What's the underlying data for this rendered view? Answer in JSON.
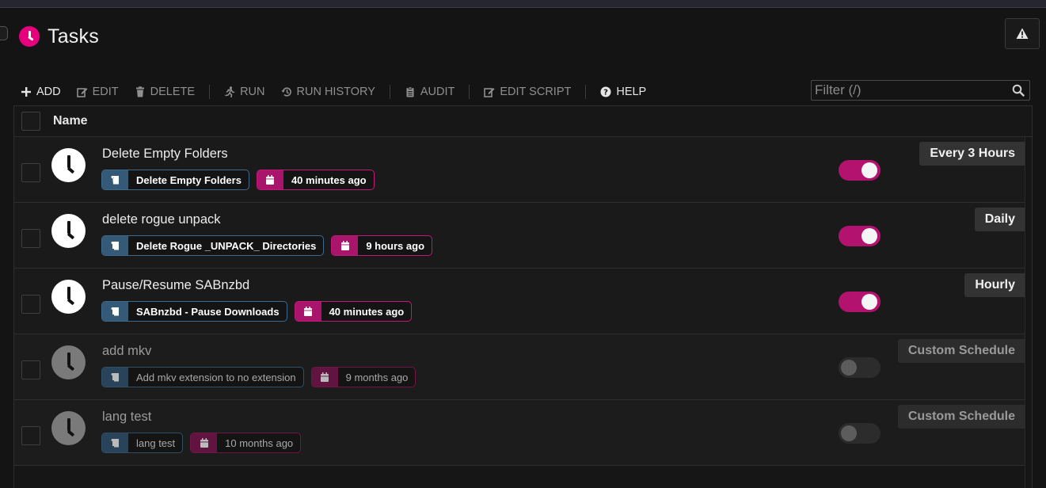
{
  "page": {
    "title": "Tasks"
  },
  "toolbar": {
    "add": "ADD",
    "edit": "EDIT",
    "delete": "DELETE",
    "run": "RUN",
    "run_history": "RUN HISTORY",
    "audit": "AUDIT",
    "edit_script": "EDIT SCRIPT",
    "help": "HELP"
  },
  "filter": {
    "placeholder": "Filter (/)"
  },
  "grid": {
    "column_name": "Name"
  },
  "colors": {
    "accent": "#e6007e",
    "toggle_on": "#b3136f",
    "script_chip": "#345a78"
  },
  "tasks": [
    {
      "name": "Delete Empty Folders",
      "script": "Delete Empty Folders",
      "last_run": "40 minutes ago",
      "enabled": true,
      "schedule": "Every 3 Hours"
    },
    {
      "name": "delete rogue unpack",
      "script": "Delete Rogue _UNPACK_ Directories",
      "last_run": "9 hours ago",
      "enabled": true,
      "schedule": "Daily"
    },
    {
      "name": "Pause/Resume SABnzbd",
      "script": "SABnzbd - Pause Downloads",
      "last_run": "40 minutes ago",
      "enabled": true,
      "schedule": "Hourly"
    },
    {
      "name": "add mkv",
      "script": "Add mkv extension to no extension",
      "last_run": "9 months ago",
      "enabled": false,
      "schedule": "Custom Schedule"
    },
    {
      "name": "lang test",
      "script": "lang test",
      "last_run": "10 months ago",
      "enabled": false,
      "schedule": "Custom Schedule"
    }
  ]
}
